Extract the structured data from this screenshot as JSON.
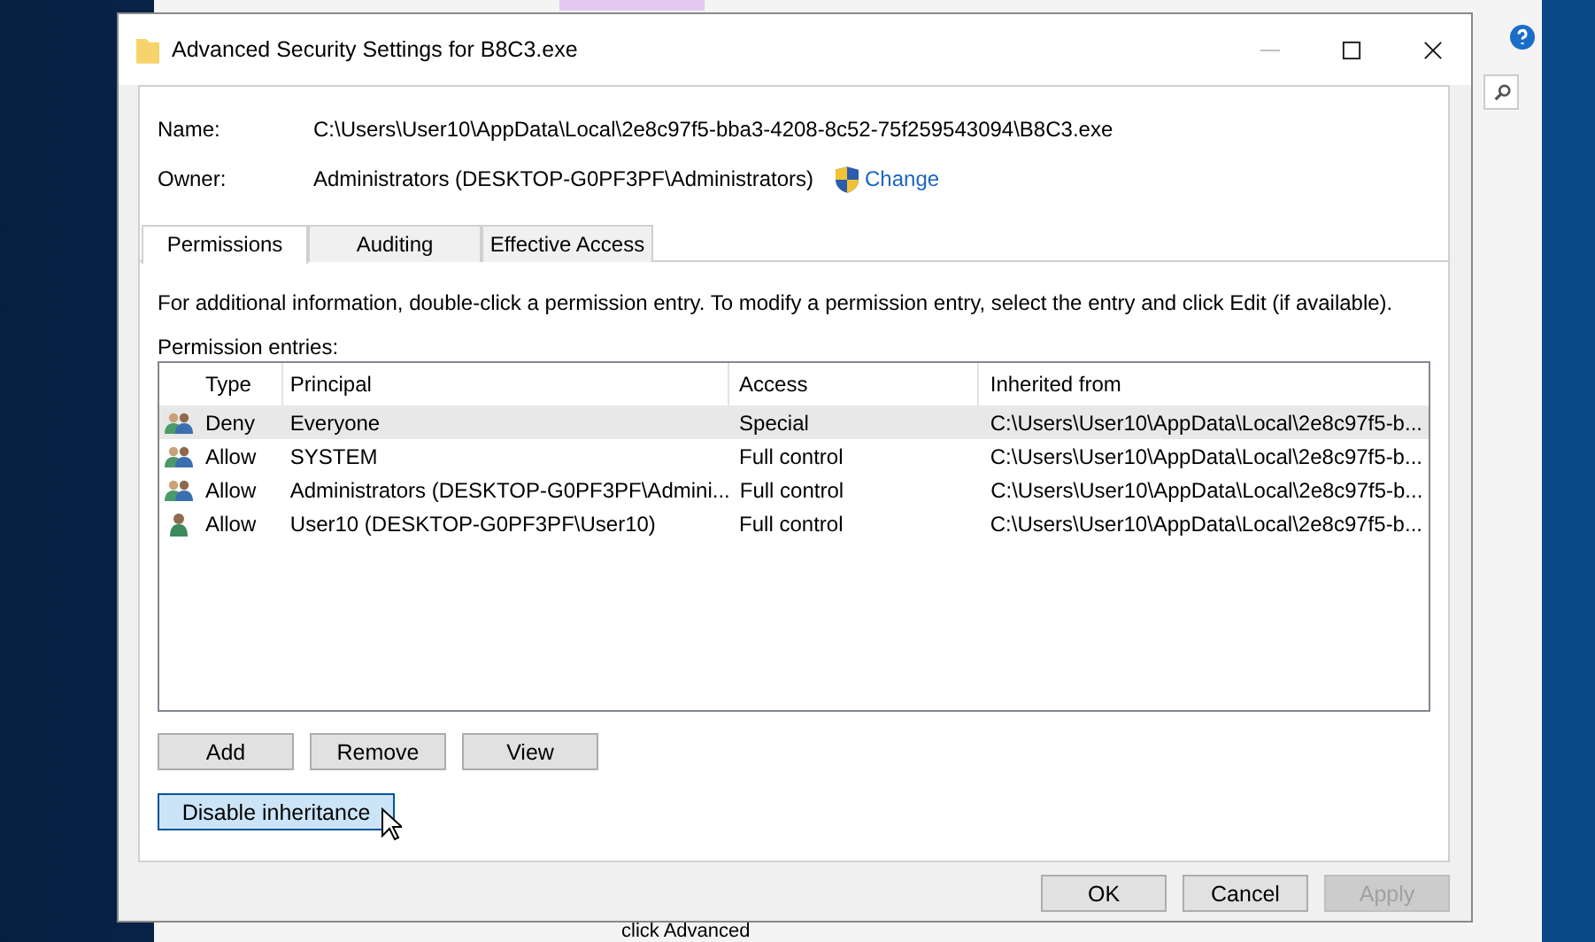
{
  "background_window": {
    "hint": "click Advanced"
  },
  "dialog": {
    "title": "Advanced Security Settings for B8C3.exe",
    "name_label": "Name:",
    "name_value": "C:\\Users\\User10\\AppData\\Local\\2e8c97f5-bba3-4208-8c52-75f259543094\\B8C3.exe",
    "owner_label": "Owner:",
    "owner_value": "Administrators (DESKTOP-G0PF3PF\\Administrators)",
    "change_link": "Change",
    "tabs": [
      {
        "label": "Permissions",
        "selected": true
      },
      {
        "label": "Auditing",
        "selected": false
      },
      {
        "label": "Effective Access",
        "selected": false
      }
    ],
    "info": "For additional information, double-click a permission entry. To modify a permission entry, select the entry and click Edit (if available).",
    "entries_label": "Permission entries:",
    "table": {
      "columns": [
        "Type",
        "Principal",
        "Access",
        "Inherited from"
      ],
      "rows": [
        {
          "kind": "group",
          "selected": true,
          "cells": [
            "Deny",
            "Everyone",
            "Special",
            "C:\\Users\\User10\\AppData\\Local\\2e8c97f5-b..."
          ]
        },
        {
          "kind": "group",
          "selected": false,
          "cells": [
            "Allow",
            "SYSTEM",
            "Full control",
            "C:\\Users\\User10\\AppData\\Local\\2e8c97f5-b..."
          ]
        },
        {
          "kind": "group",
          "selected": false,
          "cells": [
            "Allow",
            "Administrators (DESKTOP-G0PF3PF\\Admini...",
            "Full control",
            "C:\\Users\\User10\\AppData\\Local\\2e8c97f5-b..."
          ]
        },
        {
          "kind": "user",
          "selected": false,
          "cells": [
            "Allow",
            "User10 (DESKTOP-G0PF3PF\\User10)",
            "Full control",
            "C:\\Users\\User10\\AppData\\Local\\2e8c97f5-b..."
          ]
        }
      ]
    },
    "entry_buttons": [
      "Add",
      "Remove",
      "View"
    ],
    "inheritance_button": {
      "label": "Disable inheritance",
      "hovered": true
    },
    "footer_buttons": [
      {
        "label": "OK",
        "disabled": false
      },
      {
        "label": "Cancel",
        "disabled": false
      },
      {
        "label": "Apply",
        "disabled": true
      }
    ]
  }
}
